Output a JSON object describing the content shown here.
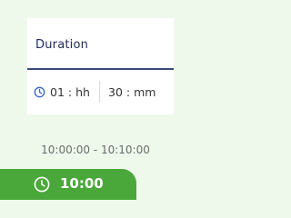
{
  "card": {
    "title": "Duration",
    "hours_value": "01 : hh",
    "minutes_value": "30 : mm"
  },
  "range_text": "10:00:00 - 10:10:00",
  "badge": {
    "time": "10:00"
  },
  "icons": {
    "small_clock": "clock-icon",
    "badge_clock": "clock-icon"
  },
  "colors": {
    "accent_green": "#4aa83a",
    "title_navy": "#1f2a5a",
    "icon_blue": "#3a63c7"
  }
}
